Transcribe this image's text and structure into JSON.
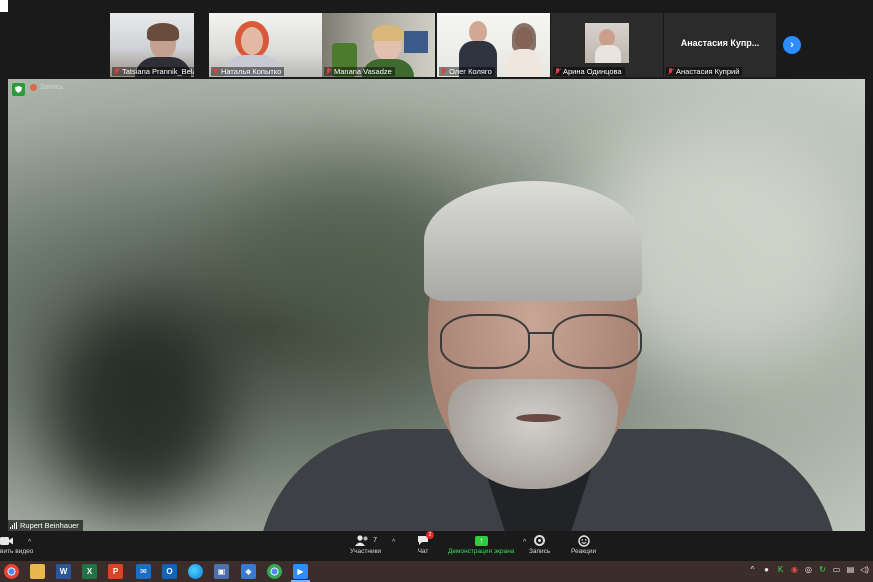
{
  "gallery": {
    "participants": [
      {
        "name": "Tatsiana Prannik_BelAPA"
      },
      {
        "name": "Наталья Копытко"
      },
      {
        "name": "Manana Vasadze"
      },
      {
        "name": "Олег Колягo"
      },
      {
        "name": "Арина Одинцова"
      },
      {
        "name": "Анастасия Куприй",
        "display_title": "Анастасия  Купр..."
      }
    ],
    "next_icon": "chevron-right-icon"
  },
  "main": {
    "speaker_name": "Rupert Beinhauer",
    "badge_text": "Запись"
  },
  "controls": {
    "video_label": "вить видео",
    "participants_label": "Участники",
    "participants_count": "7",
    "chat_label": "Чат",
    "chat_badge": "2",
    "share_label": "Демонстрация экрана",
    "record_label": "Запись",
    "reactions_label": "Реакции"
  },
  "taskbar": {
    "apps": [
      "chrome",
      "file-explorer",
      "word",
      "excel",
      "powerpoint",
      "mail",
      "outlook",
      "edge",
      "screen-tool",
      "remote-tool",
      "chrome",
      "zoom"
    ]
  }
}
